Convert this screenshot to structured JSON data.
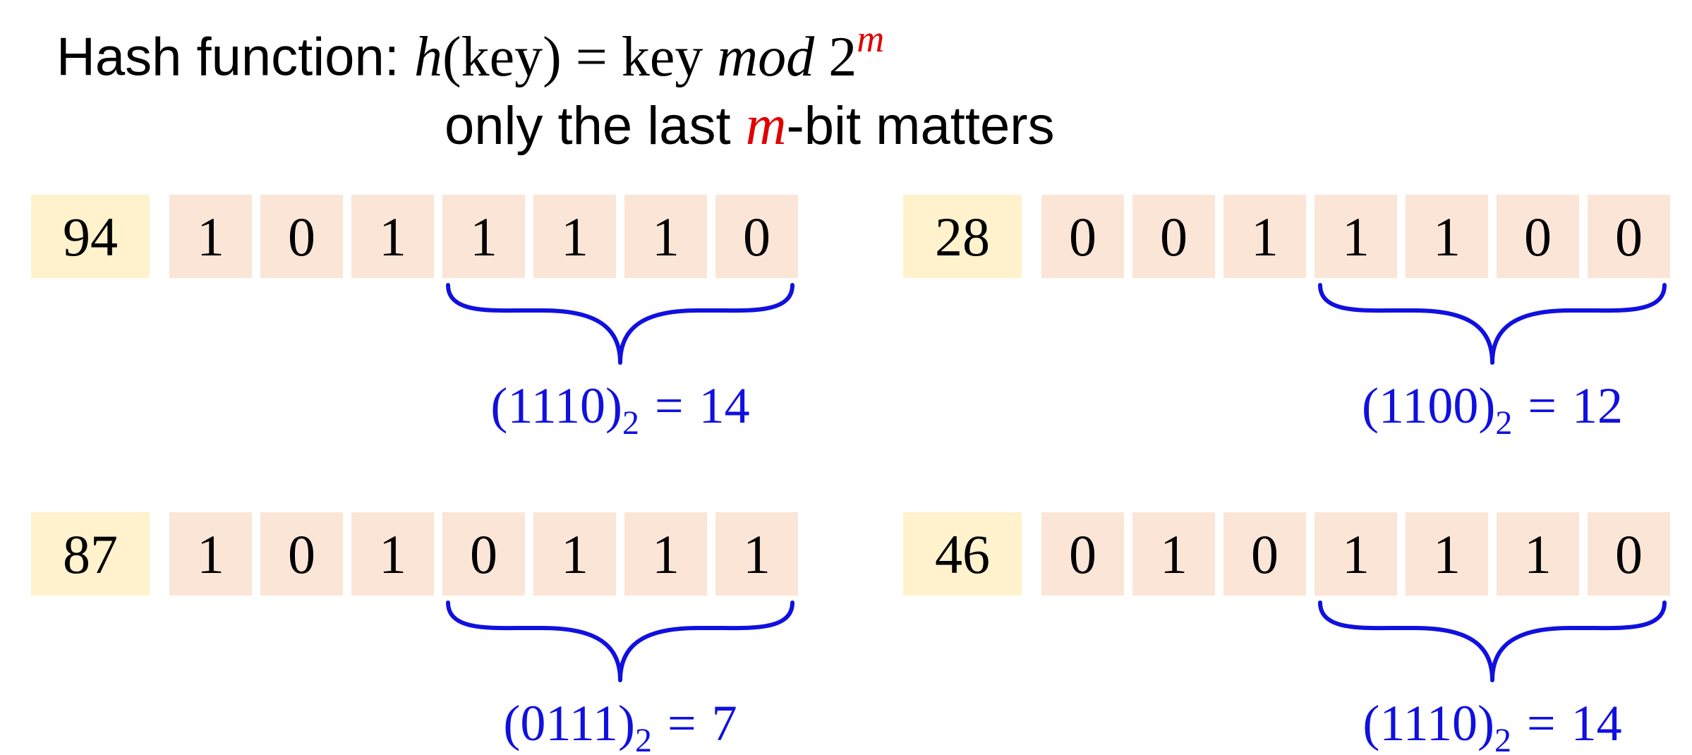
{
  "title": {
    "label": "Hash function:",
    "h": "h",
    "key_arg": "(key)",
    "equals": "=",
    "key": "key",
    "mod": "mod",
    "base": "2",
    "exponent": "m",
    "note_before": "only the last",
    "note_var": "m",
    "note_after": "-bit matters"
  },
  "colors": {
    "key_cell": "#fff2cc",
    "bit_cell": "#fbe5d6",
    "brace": "#1010e0",
    "equation": "#1010e0",
    "highlight": "#e00000"
  },
  "examples": [
    {
      "key": "94",
      "bits": [
        "1",
        "0",
        "1",
        "1",
        "1",
        "1",
        "0"
      ],
      "binary": "1110",
      "base": "2",
      "equals": "=",
      "result": "14"
    },
    {
      "key": "28",
      "bits": [
        "0",
        "0",
        "1",
        "1",
        "1",
        "0",
        "0"
      ],
      "binary": "1100",
      "base": "2",
      "equals": "=",
      "result": "12"
    },
    {
      "key": "87",
      "bits": [
        "1",
        "0",
        "1",
        "0",
        "1",
        "1",
        "1"
      ],
      "binary": "0111",
      "base": "2",
      "equals": "=",
      "result": "7"
    },
    {
      "key": "46",
      "bits": [
        "0",
        "1",
        "0",
        "1",
        "1",
        "1",
        "0"
      ],
      "binary": "1110",
      "base": "2",
      "equals": "=",
      "result": "14"
    }
  ]
}
